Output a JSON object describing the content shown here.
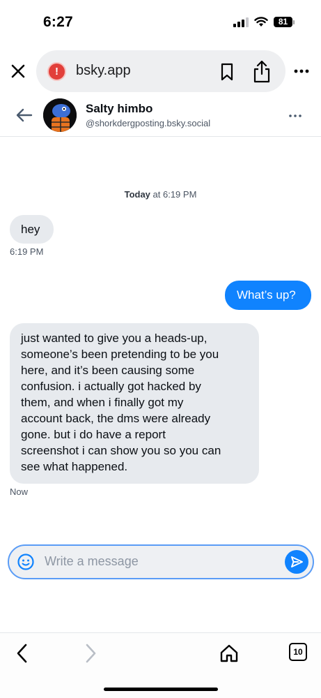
{
  "status_bar": {
    "time": "6:27",
    "battery": "81"
  },
  "browser": {
    "url": "bsky.app",
    "alert_glyph": "!",
    "icons": [
      "close-icon",
      "alert-icon",
      "bookmark-icon",
      "share-icon",
      "more-icon"
    ]
  },
  "chat_header": {
    "display_name": "Salty himbo",
    "handle": "@shorkdergposting.bsky.social"
  },
  "conversation": {
    "date_separator": {
      "day": "Today",
      "time": " at 6:19 PM"
    },
    "messages": [
      {
        "direction": "incoming",
        "text": "hey",
        "timestamp": "6:19 PM"
      },
      {
        "direction": "outgoing",
        "text": "What’s up?"
      },
      {
        "direction": "incoming",
        "lines": [
          "just wanted to give you a heads-up,",
          "someone’s been pretending to be you",
          "here, and it’s been causing some",
          "confusion. i actually got hacked by",
          "them, and when i finally got my",
          "account back, the dms were already",
          "gone. but i do have a report",
          "screenshot i can show you so you can",
          "see what happened."
        ],
        "timestamp": "Now"
      }
    ]
  },
  "composer": {
    "placeholder": "Write a message"
  },
  "toolbar": {
    "tab_count": "10"
  },
  "colors": {
    "accent": "#1083fe",
    "incoming_bubble": "#e7eaee",
    "alert": "#e23f3a"
  }
}
